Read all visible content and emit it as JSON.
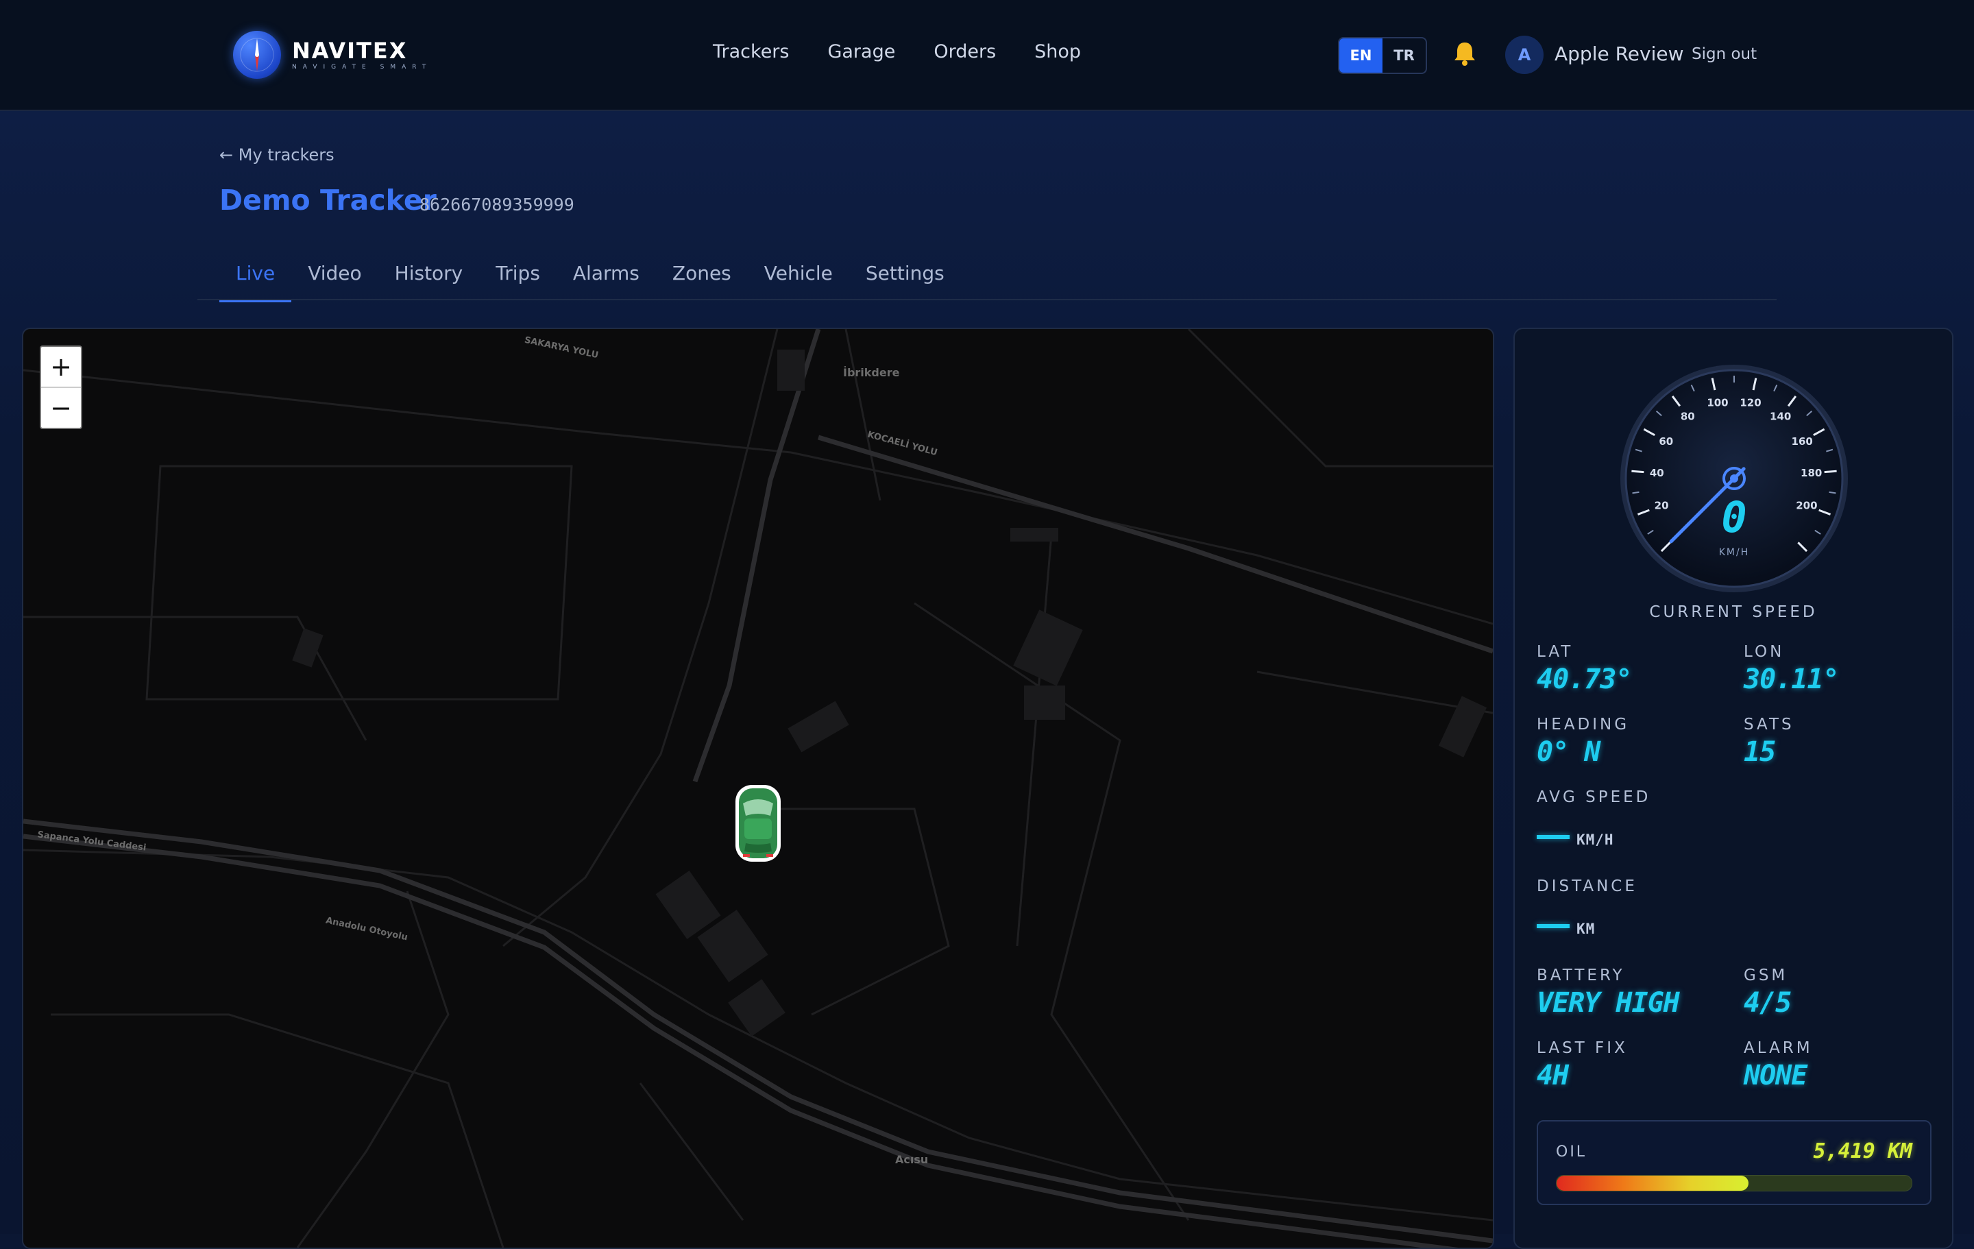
{
  "brand": {
    "name": "NAVITEX",
    "tagline": "NAVIGATE SMART"
  },
  "nav": {
    "items": [
      {
        "label": "Trackers"
      },
      {
        "label": "Garage"
      },
      {
        "label": "Orders"
      },
      {
        "label": "Shop"
      }
    ]
  },
  "lang": {
    "en": "EN",
    "tr": "TR",
    "active": "EN"
  },
  "user": {
    "initial": "A",
    "name": "Apple Review",
    "signout": "Sign out"
  },
  "breadcrumb": {
    "back_label": "My trackers"
  },
  "tracker": {
    "name": "Demo Tracker",
    "imei": "862667089359999"
  },
  "tabs": [
    {
      "label": "Live",
      "active": true
    },
    {
      "label": "Video"
    },
    {
      "label": "History"
    },
    {
      "label": "Trips"
    },
    {
      "label": "Alarms"
    },
    {
      "label": "Zones"
    },
    {
      "label": "Vehicle"
    },
    {
      "label": "Settings"
    }
  ],
  "map": {
    "zoom_in": "+",
    "zoom_out": "−",
    "labels": {
      "ibrikdere": "İbrikdere",
      "acisu": "Acısu",
      "sakarya_yolu": "SAKARYA YOLU",
      "kocaeli_yolu": "KOCAELİ YOLU",
      "sapanca": "Sapanca Yolu Caddesi",
      "anadolu": "Anadolu Otoyolu"
    }
  },
  "speedometer": {
    "ticks": [
      "20",
      "40",
      "60",
      "80",
      "100",
      "120",
      "140",
      "160",
      "180",
      "200"
    ],
    "speed": "0",
    "unit": "KM/H",
    "caption": "CURRENT SPEED",
    "value_kmh": 0
  },
  "stats": {
    "lat": {
      "label": "LAT",
      "value": "40.73°"
    },
    "lon": {
      "label": "LON",
      "value": "30.11°"
    },
    "heading": {
      "label": "HEADING",
      "value": "0° N"
    },
    "sats": {
      "label": "SATS",
      "value": "15"
    },
    "avg_speed": {
      "label": "AVG SPEED",
      "unit": "KM/H"
    },
    "distance": {
      "label": "DISTANCE",
      "unit": "KM"
    },
    "battery": {
      "label": "BATTERY",
      "value": "VERY HIGH"
    },
    "gsm": {
      "label": "GSM",
      "value": "4/5"
    },
    "last_fix": {
      "label": "LAST FIX",
      "value": "4H"
    },
    "alarm": {
      "label": "ALARM",
      "value": "NONE"
    }
  },
  "oil": {
    "label": "OIL",
    "value": "5,419 KM",
    "level_percent": 54
  },
  "colors": {
    "accent": "#3b74f5",
    "digital": "#1ecdf0",
    "oil": "#d6f03a"
  }
}
